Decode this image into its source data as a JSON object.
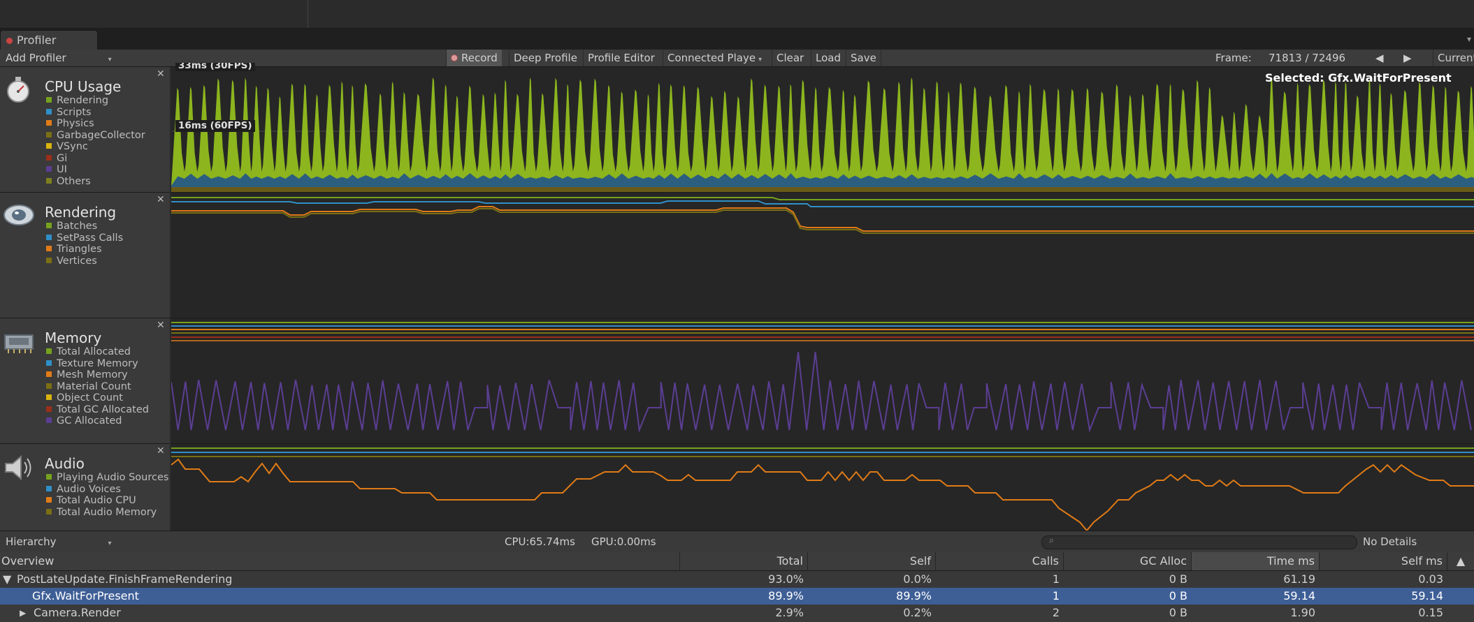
{
  "window": {
    "tab_title": "Profiler"
  },
  "toolbar": {
    "add_profiler": "Add Profiler",
    "record": "Record",
    "deep_profile": "Deep Profile",
    "profile_editor": "Profile Editor",
    "connected_player": "Connected Playe",
    "clear": "Clear",
    "load": "Load",
    "save": "Save",
    "frame_label": "Frame:",
    "frame_value": "71813 / 72496",
    "current": "Current"
  },
  "modules": [
    {
      "title": "CPU Usage",
      "icon": "cpu-stopwatch-icon",
      "legend": [
        {
          "label": "Rendering",
          "color": "#76a21e"
        },
        {
          "label": "Scripts",
          "color": "#2f8fc7"
        },
        {
          "label": "Physics",
          "color": "#e07b17"
        },
        {
          "label": "GarbageCollector",
          "color": "#7a6f14"
        },
        {
          "label": "VSync",
          "color": "#d9b30f"
        },
        {
          "label": "Gi",
          "color": "#9c2f1a"
        },
        {
          "label": "UI",
          "color": "#5b3e93"
        },
        {
          "label": "Others",
          "color": "#7e8020"
        }
      ]
    },
    {
      "title": "Rendering",
      "icon": "rendering-eye-icon",
      "legend": [
        {
          "label": "Batches",
          "color": "#76a21e"
        },
        {
          "label": "SetPass Calls",
          "color": "#2f8fc7"
        },
        {
          "label": "Triangles",
          "color": "#e07b17"
        },
        {
          "label": "Vertices",
          "color": "#7a6f14"
        }
      ]
    },
    {
      "title": "Memory",
      "icon": "memory-chip-icon",
      "legend": [
        {
          "label": "Total Allocated",
          "color": "#76a21e"
        },
        {
          "label": "Texture Memory",
          "color": "#2f8fc7"
        },
        {
          "label": "Mesh Memory",
          "color": "#e07b17"
        },
        {
          "label": "Material Count",
          "color": "#7a6f14"
        },
        {
          "label": "Object Count",
          "color": "#d9b30f"
        },
        {
          "label": "Total GC Allocated",
          "color": "#9c2f1a"
        },
        {
          "label": "GC Allocated",
          "color": "#5b3e93"
        }
      ]
    },
    {
      "title": "Audio",
      "icon": "audio-speaker-icon",
      "legend": [
        {
          "label": "Playing Audio Sources",
          "color": "#76a21e"
        },
        {
          "label": "Audio Voices",
          "color": "#2f8fc7"
        },
        {
          "label": "Total Audio CPU",
          "color": "#e07b17"
        },
        {
          "label": "Total Audio Memory",
          "color": "#7a6f14"
        }
      ]
    }
  ],
  "cpu_graph": {
    "label_top": "33ms (30FPS)",
    "label_mid": "16ms (60FPS)",
    "selected": "Selected: Gfx.WaitForPresent"
  },
  "details": {
    "view_mode": "Hierarchy",
    "cpu_time": "CPU:65.74ms",
    "gpu_time": "GPU:0.00ms",
    "search_placeholder": "",
    "details_mode": "No Details"
  },
  "table": {
    "columns": [
      "Overview",
      "Total",
      "Self",
      "Calls",
      "GC Alloc",
      "Time ms",
      "Self ms"
    ],
    "rows": [
      {
        "name": "PostLateUpdate.FinishFrameRendering",
        "expander": "▼",
        "total": "93.0%",
        "self": "0.0%",
        "calls": "1",
        "gc": "0 B",
        "time": "61.19",
        "selfms": "0.03"
      },
      {
        "name": "Gfx.WaitForPresent",
        "expander": "",
        "total": "89.9%",
        "self": "89.9%",
        "calls": "1",
        "gc": "0 B",
        "time": "59.14",
        "selfms": "59.14"
      },
      {
        "name": "Camera.Render",
        "expander": "▶",
        "total": "2.9%",
        "self": "0.2%",
        "calls": "2",
        "gc": "0 B",
        "time": "1.90",
        "selfms": "0.15"
      }
    ]
  }
}
